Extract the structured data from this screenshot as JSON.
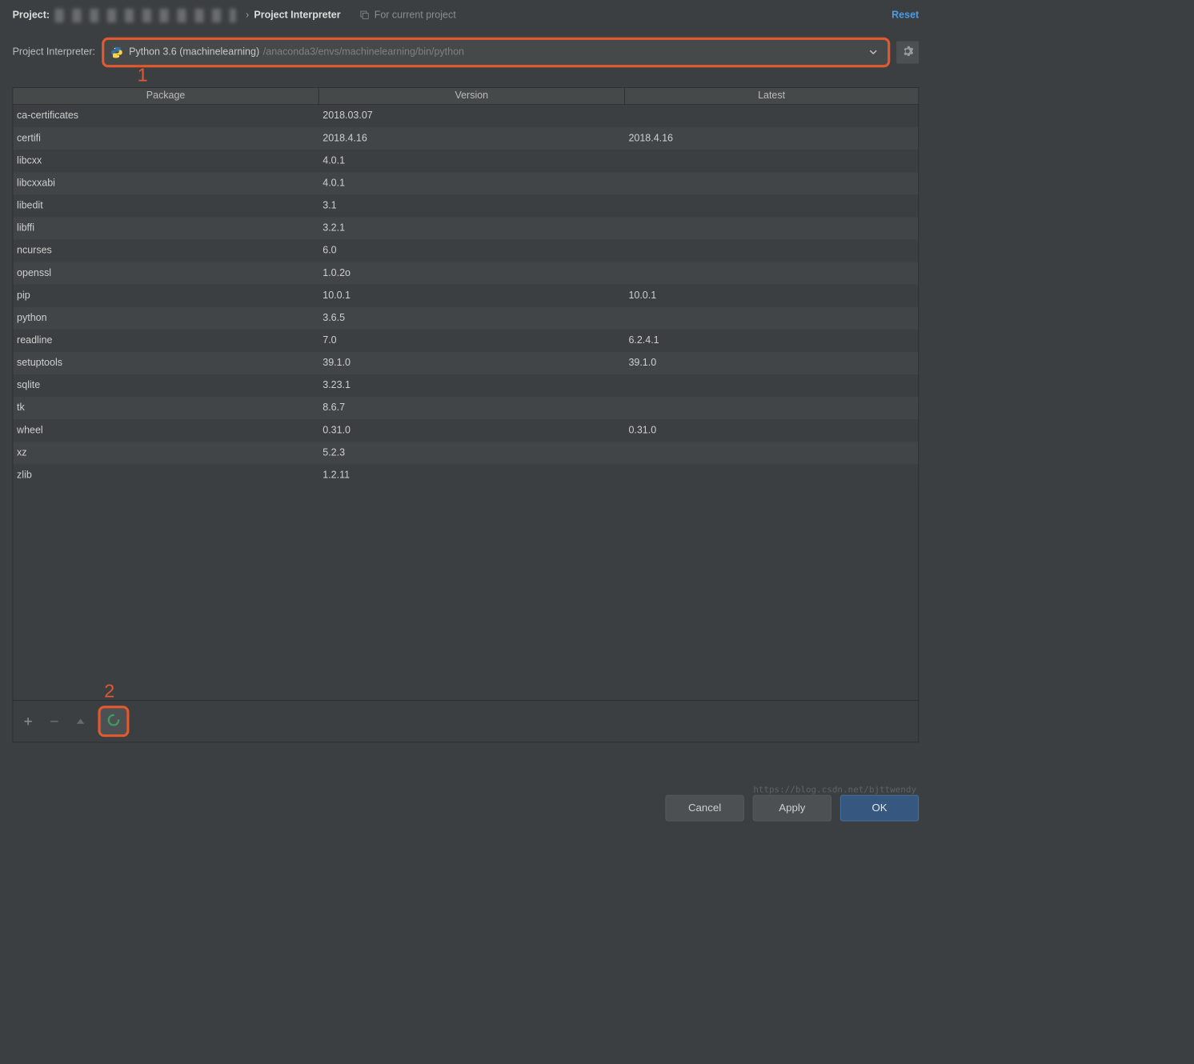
{
  "header": {
    "project_label_prefix": "Project:",
    "chevron": "›",
    "title": "Project Interpreter",
    "scope_text": "For current project",
    "reset": "Reset"
  },
  "interpreter": {
    "label": "Project Interpreter:",
    "name": "Python 3.6 (machinelearning)",
    "path": "/anaconda3/envs/machinelearning/bin/python"
  },
  "markers": {
    "one": "1",
    "two": "2"
  },
  "columns": {
    "package": "Package",
    "version": "Version",
    "latest": "Latest"
  },
  "packages": [
    {
      "name": "ca-certificates",
      "version": "2018.03.07",
      "latest": ""
    },
    {
      "name": "certifi",
      "version": "2018.4.16",
      "latest": "2018.4.16"
    },
    {
      "name": "libcxx",
      "version": "4.0.1",
      "latest": ""
    },
    {
      "name": "libcxxabi",
      "version": "4.0.1",
      "latest": ""
    },
    {
      "name": "libedit",
      "version": "3.1",
      "latest": ""
    },
    {
      "name": "libffi",
      "version": "3.2.1",
      "latest": ""
    },
    {
      "name": "ncurses",
      "version": "6.0",
      "latest": ""
    },
    {
      "name": "openssl",
      "version": "1.0.2o",
      "latest": ""
    },
    {
      "name": "pip",
      "version": "10.0.1",
      "latest": "10.0.1"
    },
    {
      "name": "python",
      "version": "3.6.5",
      "latest": ""
    },
    {
      "name": "readline",
      "version": "7.0",
      "latest": "6.2.4.1"
    },
    {
      "name": "setuptools",
      "version": "39.1.0",
      "latest": "39.1.0"
    },
    {
      "name": "sqlite",
      "version": "3.23.1",
      "latest": ""
    },
    {
      "name": "tk",
      "version": "8.6.7",
      "latest": ""
    },
    {
      "name": "wheel",
      "version": "0.31.0",
      "latest": "0.31.0"
    },
    {
      "name": "xz",
      "version": "5.2.3",
      "latest": ""
    },
    {
      "name": "zlib",
      "version": "1.2.11",
      "latest": ""
    }
  ],
  "buttons": {
    "cancel": "Cancel",
    "apply": "Apply",
    "ok": "OK"
  },
  "watermark": "https://blog.csdn.net/bjttwendy"
}
